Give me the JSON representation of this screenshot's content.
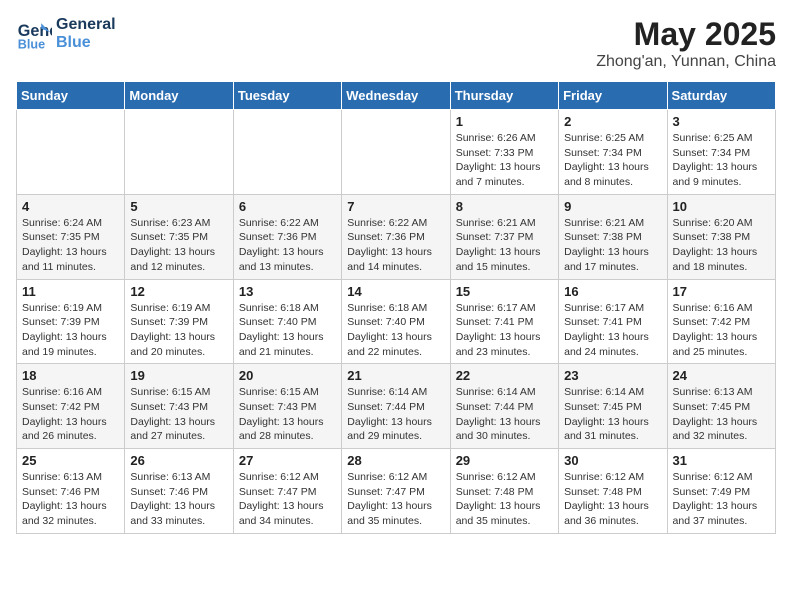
{
  "header": {
    "logo_line1": "General",
    "logo_line2": "Blue",
    "month": "May 2025",
    "location": "Zhong'an, Yunnan, China"
  },
  "days_of_week": [
    "Sunday",
    "Monday",
    "Tuesday",
    "Wednesday",
    "Thursday",
    "Friday",
    "Saturday"
  ],
  "weeks": [
    [
      {
        "day": "",
        "info": ""
      },
      {
        "day": "",
        "info": ""
      },
      {
        "day": "",
        "info": ""
      },
      {
        "day": "",
        "info": ""
      },
      {
        "day": "1",
        "info": "Sunrise: 6:26 AM\nSunset: 7:33 PM\nDaylight: 13 hours and 7 minutes."
      },
      {
        "day": "2",
        "info": "Sunrise: 6:25 AM\nSunset: 7:34 PM\nDaylight: 13 hours and 8 minutes."
      },
      {
        "day": "3",
        "info": "Sunrise: 6:25 AM\nSunset: 7:34 PM\nDaylight: 13 hours and 9 minutes."
      }
    ],
    [
      {
        "day": "4",
        "info": "Sunrise: 6:24 AM\nSunset: 7:35 PM\nDaylight: 13 hours and 11 minutes."
      },
      {
        "day": "5",
        "info": "Sunrise: 6:23 AM\nSunset: 7:35 PM\nDaylight: 13 hours and 12 minutes."
      },
      {
        "day": "6",
        "info": "Sunrise: 6:22 AM\nSunset: 7:36 PM\nDaylight: 13 hours and 13 minutes."
      },
      {
        "day": "7",
        "info": "Sunrise: 6:22 AM\nSunset: 7:36 PM\nDaylight: 13 hours and 14 minutes."
      },
      {
        "day": "8",
        "info": "Sunrise: 6:21 AM\nSunset: 7:37 PM\nDaylight: 13 hours and 15 minutes."
      },
      {
        "day": "9",
        "info": "Sunrise: 6:21 AM\nSunset: 7:38 PM\nDaylight: 13 hours and 17 minutes."
      },
      {
        "day": "10",
        "info": "Sunrise: 6:20 AM\nSunset: 7:38 PM\nDaylight: 13 hours and 18 minutes."
      }
    ],
    [
      {
        "day": "11",
        "info": "Sunrise: 6:19 AM\nSunset: 7:39 PM\nDaylight: 13 hours and 19 minutes."
      },
      {
        "day": "12",
        "info": "Sunrise: 6:19 AM\nSunset: 7:39 PM\nDaylight: 13 hours and 20 minutes."
      },
      {
        "day": "13",
        "info": "Sunrise: 6:18 AM\nSunset: 7:40 PM\nDaylight: 13 hours and 21 minutes."
      },
      {
        "day": "14",
        "info": "Sunrise: 6:18 AM\nSunset: 7:40 PM\nDaylight: 13 hours and 22 minutes."
      },
      {
        "day": "15",
        "info": "Sunrise: 6:17 AM\nSunset: 7:41 PM\nDaylight: 13 hours and 23 minutes."
      },
      {
        "day": "16",
        "info": "Sunrise: 6:17 AM\nSunset: 7:41 PM\nDaylight: 13 hours and 24 minutes."
      },
      {
        "day": "17",
        "info": "Sunrise: 6:16 AM\nSunset: 7:42 PM\nDaylight: 13 hours and 25 minutes."
      }
    ],
    [
      {
        "day": "18",
        "info": "Sunrise: 6:16 AM\nSunset: 7:42 PM\nDaylight: 13 hours and 26 minutes."
      },
      {
        "day": "19",
        "info": "Sunrise: 6:15 AM\nSunset: 7:43 PM\nDaylight: 13 hours and 27 minutes."
      },
      {
        "day": "20",
        "info": "Sunrise: 6:15 AM\nSunset: 7:43 PM\nDaylight: 13 hours and 28 minutes."
      },
      {
        "day": "21",
        "info": "Sunrise: 6:14 AM\nSunset: 7:44 PM\nDaylight: 13 hours and 29 minutes."
      },
      {
        "day": "22",
        "info": "Sunrise: 6:14 AM\nSunset: 7:44 PM\nDaylight: 13 hours and 30 minutes."
      },
      {
        "day": "23",
        "info": "Sunrise: 6:14 AM\nSunset: 7:45 PM\nDaylight: 13 hours and 31 minutes."
      },
      {
        "day": "24",
        "info": "Sunrise: 6:13 AM\nSunset: 7:45 PM\nDaylight: 13 hours and 32 minutes."
      }
    ],
    [
      {
        "day": "25",
        "info": "Sunrise: 6:13 AM\nSunset: 7:46 PM\nDaylight: 13 hours and 32 minutes."
      },
      {
        "day": "26",
        "info": "Sunrise: 6:13 AM\nSunset: 7:46 PM\nDaylight: 13 hours and 33 minutes."
      },
      {
        "day": "27",
        "info": "Sunrise: 6:12 AM\nSunset: 7:47 PM\nDaylight: 13 hours and 34 minutes."
      },
      {
        "day": "28",
        "info": "Sunrise: 6:12 AM\nSunset: 7:47 PM\nDaylight: 13 hours and 35 minutes."
      },
      {
        "day": "29",
        "info": "Sunrise: 6:12 AM\nSunset: 7:48 PM\nDaylight: 13 hours and 35 minutes."
      },
      {
        "day": "30",
        "info": "Sunrise: 6:12 AM\nSunset: 7:48 PM\nDaylight: 13 hours and 36 minutes."
      },
      {
        "day": "31",
        "info": "Sunrise: 6:12 AM\nSunset: 7:49 PM\nDaylight: 13 hours and 37 minutes."
      }
    ]
  ]
}
